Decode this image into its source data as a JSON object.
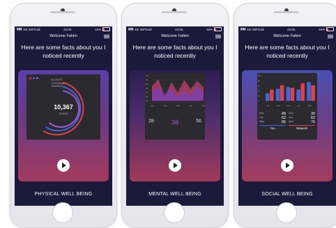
{
  "phones": [
    {
      "status": {
        "carrier": "EE WiFiCall",
        "time": "22:06",
        "battery": "15%"
      },
      "header": {
        "title": "Welcome Fahim"
      },
      "headline": "Here are some facts about you I noticed recently",
      "metric": {
        "legend": [
          "ACTIVITY",
          "STATIONARY",
          "RUNNING"
        ],
        "value": "10,367",
        "unit": "STEPS"
      },
      "footer": "PHYSICAL WELL BEING"
    },
    {
      "status": {
        "carrier": "EE WiFiCall",
        "time": "22:06",
        "battery": "15%"
      },
      "header": {
        "title": "Welcome Fahim"
      },
      "headline": "Here are some facts about you I noticed recently",
      "chart": {
        "y_ticks": [
          "70",
          "60",
          "50",
          "40",
          "30",
          "20",
          "10"
        ],
        "x_ticks": [
          "Jan",
          "Feb",
          "Mar",
          "Apr",
          "May"
        ]
      },
      "scores": [
        "28",
        "38",
        "56"
      ],
      "footer": "MENTAL WELL BEING"
    },
    {
      "status": {
        "carrier": "EE WiFiCall",
        "time": "22:06",
        "battery": "15%"
      },
      "header": {
        "title": "Welcome Fahim"
      },
      "headline": "Here are some facts about you I noticed recently",
      "chart": {
        "y_ticks": [
          "100",
          "90",
          "80",
          "70",
          "60",
          "50",
          "40",
          "30",
          "20",
          "10",
          "0"
        ],
        "x_ticks": [
          "Jan",
          "Feb",
          "Mar",
          "Apr",
          "May"
        ]
      },
      "you": {
        "label": "You",
        "rows": [
          {
            "k": "Mon",
            "v": "48"
          },
          {
            "k": "Tue",
            "v": "52"
          },
          {
            "k": "Wed",
            "v": "85"
          }
        ]
      },
      "network": {
        "label": "Network",
        "rows": [
          {
            "k": "Mon",
            "v": "30"
          },
          {
            "k": "Tue",
            "v": "62"
          },
          {
            "k": "Wed",
            "v": "76"
          }
        ]
      },
      "footer": "SOCIAL WELL BEING"
    }
  ],
  "colors": {
    "accent_red": "#e04050",
    "accent_blue": "#4466dd",
    "accent_purple": "#a05ad0"
  },
  "chart_data": [
    {
      "type": "area",
      "x": [
        "Jan",
        "Feb",
        "Mar",
        "Apr",
        "May"
      ],
      "series": [
        {
          "values": [
            45,
            62,
            20,
            55,
            30,
            60,
            38,
            58,
            42
          ]
        },
        {
          "values": [
            30,
            42,
            25,
            40,
            18,
            35,
            22,
            45,
            30
          ]
        }
      ],
      "ylim": [
        10,
        70
      ]
    },
    {
      "type": "bar",
      "categories": [
        "Jan",
        "Feb",
        "Mar",
        "Apr",
        "May"
      ],
      "series": [
        {
          "values": [
            30,
            48,
            55,
            45,
            75
          ]
        },
        {
          "values": [
            45,
            62,
            52,
            70,
            62
          ]
        }
      ],
      "ylim": [
        0,
        100
      ]
    }
  ]
}
